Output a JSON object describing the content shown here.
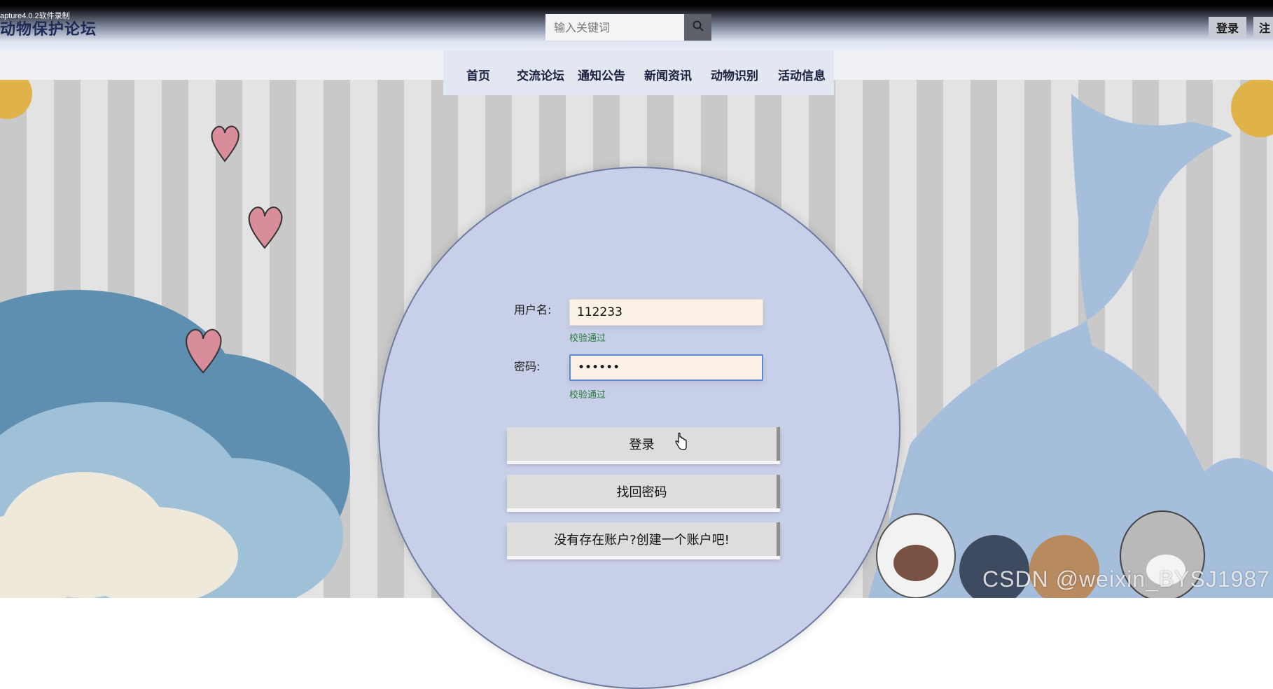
{
  "capture_label": "apture4.0.2软件录制",
  "header": {
    "site_title": "动物保护论坛",
    "search_placeholder": "输入关键词",
    "search_icon": "search-icon",
    "login_label": "登录",
    "register_label": "注"
  },
  "nav": {
    "items": [
      {
        "label": "首页"
      },
      {
        "label": "交流论坛"
      },
      {
        "label": "通知公告"
      },
      {
        "label": "新闻资讯"
      },
      {
        "label": "动物识别"
      },
      {
        "label": "活动信息"
      }
    ]
  },
  "form": {
    "username_label": "用户名:",
    "username_value": "112233",
    "username_status": "校验通过",
    "password_label": "密码:",
    "password_value": "••••••",
    "password_status": "校验通过",
    "login_button": "登录",
    "forgot_button": "找回密码",
    "register_button": "没有存在账户?创建一个账户吧!"
  },
  "watermark": "CSDN @weixin_BYSJ1987",
  "colors": {
    "accent": "#5b8bd8",
    "valid": "#2a7a3a",
    "circle": "#c8cfe8"
  }
}
